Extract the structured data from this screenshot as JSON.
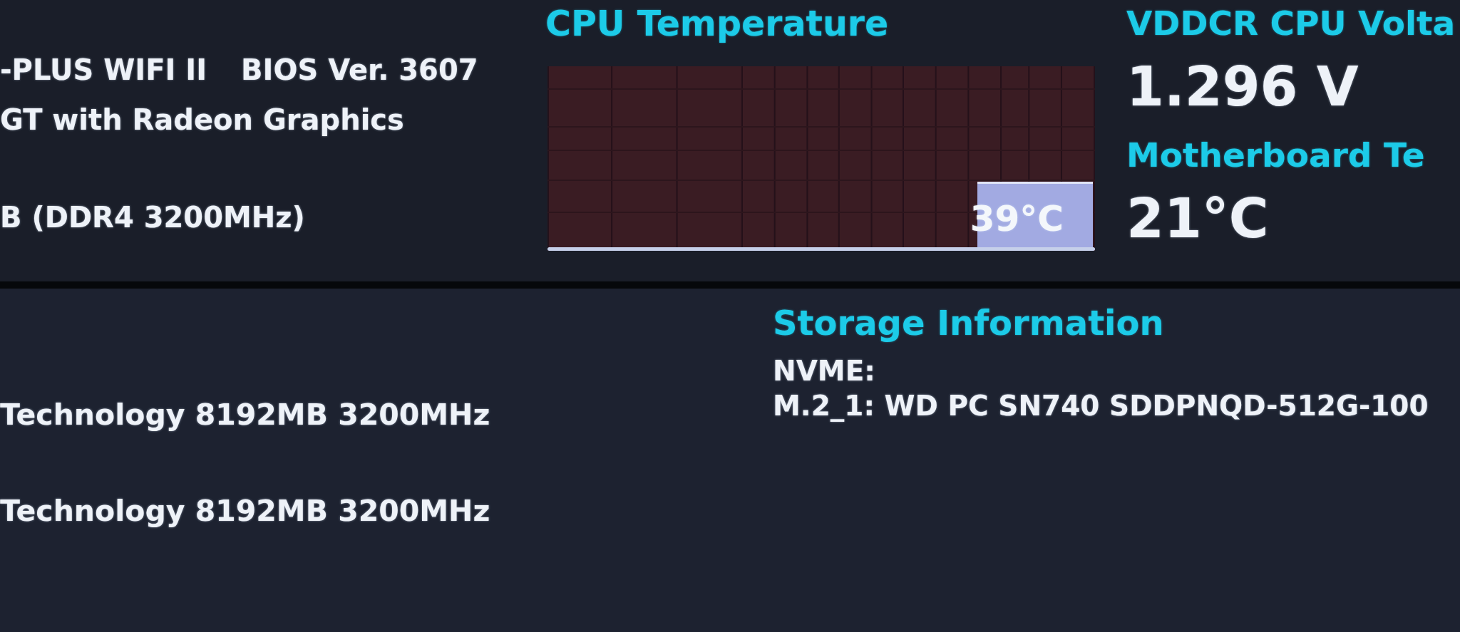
{
  "board": {
    "model": "-PLUS WIFI II",
    "bios": "BIOS Ver. 3607",
    "cpu": "GT with Radeon Graphics",
    "memory": "B (DDR4 3200MHz)"
  },
  "cpu_temperature": {
    "title": "CPU Temperature",
    "reading": "39°C"
  },
  "sensors": [
    {
      "title": "VDDCR CPU Volta",
      "value": "1.296 V"
    },
    {
      "title": "Motherboard Te",
      "value": "21°C"
    }
  ],
  "memory_modules": [
    "Technology 8192MB 3200MHz",
    "Technology 8192MB 3200MHz"
  ],
  "storage": {
    "title": "Storage Information",
    "type": "NVME:",
    "drives": [
      "M.2_1: WD PC SN740 SDDPNQD-512G-100"
    ]
  }
}
